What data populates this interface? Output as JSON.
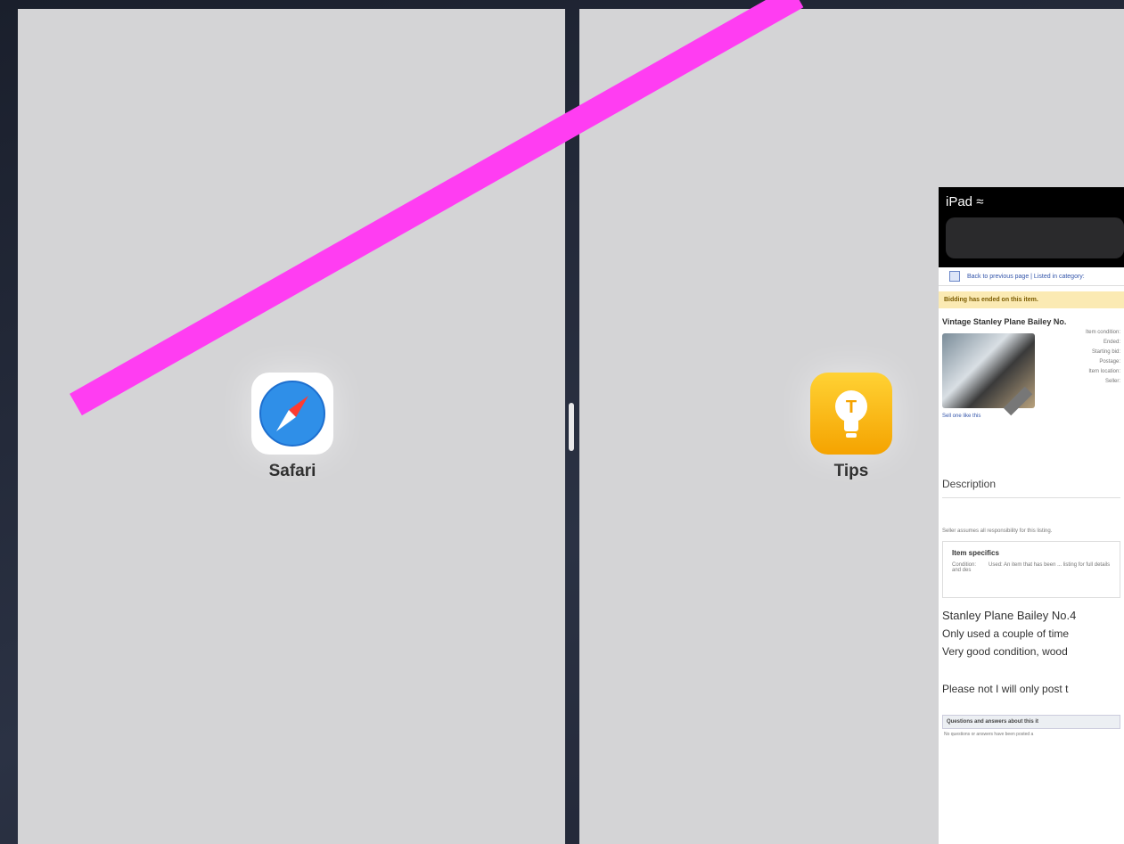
{
  "left_app": {
    "label": "Safari",
    "icon": "safari-compass-icon"
  },
  "right_app": {
    "label": "Tips",
    "icon": "lightbulb-icon"
  },
  "ipad_window": {
    "carrier": "iPad",
    "wifi_icon": "wifi-icon",
    "breadcrumb": "Back to previous page | Listed in category:",
    "notice": "Bidding has ended on this item.",
    "item_title": "Vintage Stanley Plane Bailey No.",
    "details": [
      "Item condition:",
      "Ended:",
      "Starting bid:",
      "Postage:",
      "Item location:",
      "Seller:"
    ],
    "sell_link": "Sell one like this",
    "description_heading": "Description",
    "seller_note": "Seller assumes all responsibility for this listing.",
    "specifics_heading": "Item specifics",
    "condition_label": "Condition:",
    "condition_text": "Used: An item that has been ... listing for full details and des",
    "body": [
      "Stanley Plane Bailey No.4",
      "Only used a couple of time",
      "Very good condition, wood",
      "Please not I will only post t"
    ],
    "qa_heading": "Questions and answers about this it",
    "qa_sub": "No questions or answers have been posted a"
  },
  "colors": {
    "annotation_stroke": "#ff3df2",
    "pane_background": "#d4d4d6",
    "frame": "#232938"
  }
}
